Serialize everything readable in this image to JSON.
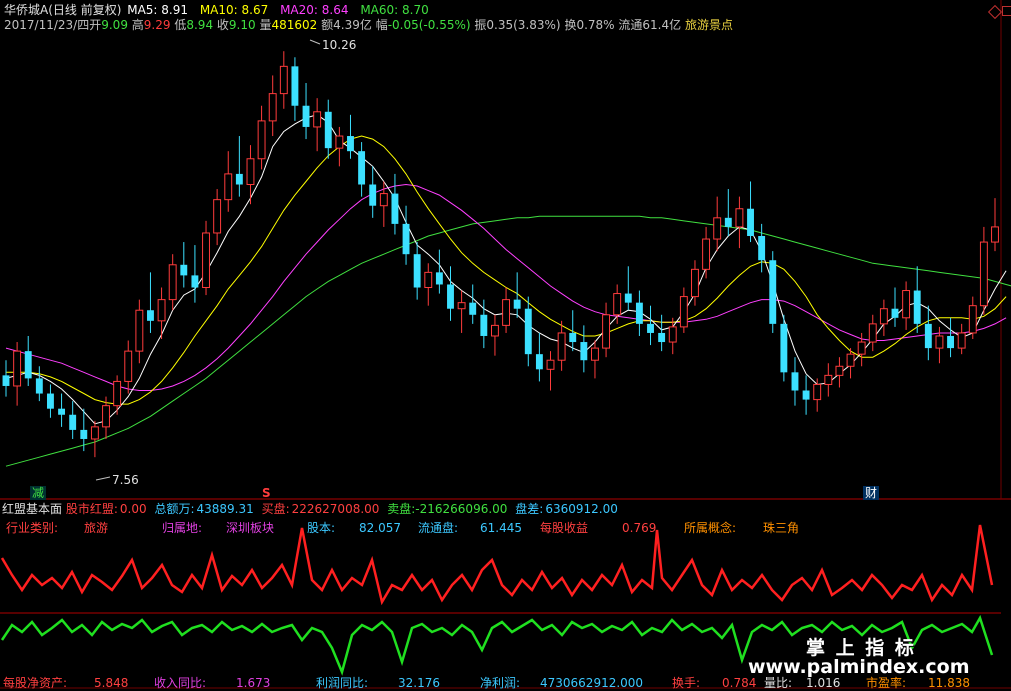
{
  "header": {
    "title": "华侨城A(日线 前复权)",
    "ma5_label": "MA5: 8.91",
    "ma10_label": "MA10: 8.67",
    "ma20_label": "MA20: 8.64",
    "ma60_label": "MA60: 8.70",
    "date": "2017/11/23/四",
    "open_label": "开",
    "open_value": "9.09",
    "high_label": "高",
    "high_value": "9.29",
    "low_label": "低",
    "low_value": "8.94",
    "close_label": "收",
    "close_value": "9.10",
    "volume_label": "量",
    "volume_value": "481602",
    "amount": "额4.39亿",
    "change_label": "幅",
    "change_value": "-0.05(-0.55%)",
    "amplitude": "振0.35(3.83%)",
    "turnover": "换0.78%",
    "float_cap": "流通61.4亿",
    "concept": "旅游景点"
  },
  "markers": {
    "max_price": "10.26",
    "min_price": "7.56",
    "event_reduce": "减",
    "event_s": "S",
    "event_finance": "财"
  },
  "indicator_bar": {
    "name": "红盟基本面",
    "item1_label": "股市红盟:",
    "item1_value": "0.00",
    "item2_label": "总额万:",
    "item2_value": "43889.31",
    "item3_label": "买盘:",
    "item3_value": "222627008.00",
    "item4_label": "卖盘:",
    "item4_value": "-216266096.00",
    "item5_label": "盘差:",
    "item5_value": "6360912.00"
  },
  "fundamentals_top": {
    "industry_label": "行业类别:",
    "industry_value": "旅游",
    "region_label": "归属地:",
    "region_value": "深圳板块",
    "shares_label": "股本:",
    "shares_value": "82.057",
    "float_label": "流通盘:",
    "float_value": "61.445",
    "eps_label": "每股收益",
    "eps_value": "0.769",
    "concept_label": "所属概念:",
    "concept_value": "珠三角"
  },
  "fundamentals_bottom": {
    "nav_label": "每股净资产:",
    "nav_value": "5.848",
    "rev_label": "收入同比:",
    "rev_value": "1.673",
    "profit_growth_label": "利润同比:",
    "profit_growth_value": "32.176",
    "net_profit_label": "净利润:",
    "net_profit_value": "4730662912.000",
    "turnover_label": "换手:",
    "turnover_value": "0.784",
    "volume_ratio_label": "量比:",
    "volume_ratio_value": "1.016",
    "pe_label": "市盈率:",
    "pe_value": "11.838"
  },
  "watermark": {
    "line1": "掌 上 指 标",
    "line2": "www.palmindex.com"
  },
  "colors": {
    "up": "#ff3c3c",
    "down": "#3ce0ff",
    "ma5": "#ffffff",
    "ma10": "#ffff00",
    "ma20": "#ff40ff",
    "ma60": "#40e040",
    "label_cyan": "#3cc8ff",
    "label_magenta": "#e040e0",
    "label_red": "#ff4040",
    "label_orange": "#ff9000",
    "label_yellow": "#e8d040"
  },
  "chart_data": {
    "type": "candlestick",
    "title": "华侨城A(日线 前复权)",
    "ylim": [
      7.35,
      10.4
    ],
    "candles": [
      {
        "o": 8.12,
        "h": 8.22,
        "l": 7.98,
        "c": 8.05
      },
      {
        "o": 8.05,
        "h": 8.34,
        "l": 7.92,
        "c": 8.28
      },
      {
        "o": 8.28,
        "h": 8.38,
        "l": 8.05,
        "c": 8.1
      },
      {
        "o": 8.1,
        "h": 8.18,
        "l": 7.95,
        "c": 8.0
      },
      {
        "o": 8.0,
        "h": 8.06,
        "l": 7.84,
        "c": 7.9
      },
      {
        "o": 7.9,
        "h": 8.0,
        "l": 7.78,
        "c": 7.86
      },
      {
        "o": 7.86,
        "h": 7.95,
        "l": 7.7,
        "c": 7.76
      },
      {
        "o": 7.76,
        "h": 7.9,
        "l": 7.62,
        "c": 7.7
      },
      {
        "o": 7.7,
        "h": 7.82,
        "l": 7.58,
        "c": 7.78
      },
      {
        "o": 7.78,
        "h": 7.98,
        "l": 7.7,
        "c": 7.92
      },
      {
        "o": 7.92,
        "h": 8.12,
        "l": 7.86,
        "c": 8.08
      },
      {
        "o": 8.08,
        "h": 8.35,
        "l": 8.0,
        "c": 8.28
      },
      {
        "o": 8.28,
        "h": 8.62,
        "l": 8.2,
        "c": 8.55
      },
      {
        "o": 8.55,
        "h": 8.8,
        "l": 8.4,
        "c": 8.48
      },
      {
        "o": 8.48,
        "h": 8.7,
        "l": 8.36,
        "c": 8.62
      },
      {
        "o": 8.62,
        "h": 8.92,
        "l": 8.55,
        "c": 8.85
      },
      {
        "o": 8.85,
        "h": 9.0,
        "l": 8.7,
        "c": 8.78
      },
      {
        "o": 8.78,
        "h": 8.98,
        "l": 8.6,
        "c": 8.7
      },
      {
        "o": 8.7,
        "h": 9.14,
        "l": 8.65,
        "c": 9.06
      },
      {
        "o": 9.06,
        "h": 9.35,
        "l": 8.98,
        "c": 9.28
      },
      {
        "o": 9.28,
        "h": 9.6,
        "l": 9.2,
        "c": 9.45
      },
      {
        "o": 9.45,
        "h": 9.7,
        "l": 9.3,
        "c": 9.38
      },
      {
        "o": 9.38,
        "h": 9.64,
        "l": 9.25,
        "c": 9.55
      },
      {
        "o": 9.55,
        "h": 9.9,
        "l": 9.48,
        "c": 9.8
      },
      {
        "o": 9.8,
        "h": 10.1,
        "l": 9.7,
        "c": 9.98
      },
      {
        "o": 9.98,
        "h": 10.26,
        "l": 9.88,
        "c": 10.16
      },
      {
        "o": 10.16,
        "h": 10.22,
        "l": 9.8,
        "c": 9.9
      },
      {
        "o": 9.9,
        "h": 10.05,
        "l": 9.68,
        "c": 9.76
      },
      {
        "o": 9.76,
        "h": 9.95,
        "l": 9.6,
        "c": 9.86
      },
      {
        "o": 9.86,
        "h": 9.94,
        "l": 9.55,
        "c": 9.62
      },
      {
        "o": 9.62,
        "h": 9.76,
        "l": 9.5,
        "c": 9.7
      },
      {
        "o": 9.7,
        "h": 9.84,
        "l": 9.55,
        "c": 9.6
      },
      {
        "o": 9.6,
        "h": 9.66,
        "l": 9.3,
        "c": 9.38
      },
      {
        "o": 9.38,
        "h": 9.5,
        "l": 9.16,
        "c": 9.24
      },
      {
        "o": 9.24,
        "h": 9.4,
        "l": 9.1,
        "c": 9.32
      },
      {
        "o": 9.32,
        "h": 9.45,
        "l": 9.05,
        "c": 9.12
      },
      {
        "o": 9.12,
        "h": 9.24,
        "l": 8.85,
        "c": 8.92
      },
      {
        "o": 8.92,
        "h": 9.0,
        "l": 8.62,
        "c": 8.7
      },
      {
        "o": 8.7,
        "h": 8.86,
        "l": 8.58,
        "c": 8.8
      },
      {
        "o": 8.8,
        "h": 8.95,
        "l": 8.66,
        "c": 8.72
      },
      {
        "o": 8.72,
        "h": 8.84,
        "l": 8.48,
        "c": 8.56
      },
      {
        "o": 8.56,
        "h": 8.68,
        "l": 8.4,
        "c": 8.6
      },
      {
        "o": 8.6,
        "h": 8.72,
        "l": 8.46,
        "c": 8.52
      },
      {
        "o": 8.52,
        "h": 8.62,
        "l": 8.3,
        "c": 8.38
      },
      {
        "o": 8.38,
        "h": 8.52,
        "l": 8.25,
        "c": 8.45
      },
      {
        "o": 8.45,
        "h": 8.7,
        "l": 8.4,
        "c": 8.62
      },
      {
        "o": 8.62,
        "h": 8.8,
        "l": 8.5,
        "c": 8.56
      },
      {
        "o": 8.56,
        "h": 8.64,
        "l": 8.18,
        "c": 8.26
      },
      {
        "o": 8.26,
        "h": 8.4,
        "l": 8.08,
        "c": 8.16
      },
      {
        "o": 8.16,
        "h": 8.28,
        "l": 8.02,
        "c": 8.22
      },
      {
        "o": 8.22,
        "h": 8.48,
        "l": 8.15,
        "c": 8.4
      },
      {
        "o": 8.4,
        "h": 8.55,
        "l": 8.28,
        "c": 8.34
      },
      {
        "o": 8.34,
        "h": 8.45,
        "l": 8.14,
        "c": 8.22
      },
      {
        "o": 8.22,
        "h": 8.35,
        "l": 8.1,
        "c": 8.3
      },
      {
        "o": 8.3,
        "h": 8.6,
        "l": 8.24,
        "c": 8.52
      },
      {
        "o": 8.52,
        "h": 8.72,
        "l": 8.46,
        "c": 8.66
      },
      {
        "o": 8.66,
        "h": 8.84,
        "l": 8.55,
        "c": 8.6
      },
      {
        "o": 8.6,
        "h": 8.68,
        "l": 8.38,
        "c": 8.46
      },
      {
        "o": 8.46,
        "h": 8.58,
        "l": 8.32,
        "c": 8.4
      },
      {
        "o": 8.4,
        "h": 8.52,
        "l": 8.28,
        "c": 8.34
      },
      {
        "o": 8.34,
        "h": 8.5,
        "l": 8.26,
        "c": 8.44
      },
      {
        "o": 8.44,
        "h": 8.7,
        "l": 8.4,
        "c": 8.64
      },
      {
        "o": 8.64,
        "h": 8.88,
        "l": 8.58,
        "c": 8.82
      },
      {
        "o": 8.82,
        "h": 9.1,
        "l": 8.76,
        "c": 9.02
      },
      {
        "o": 9.02,
        "h": 9.3,
        "l": 8.94,
        "c": 9.16
      },
      {
        "o": 9.16,
        "h": 9.35,
        "l": 9.04,
        "c": 9.1
      },
      {
        "o": 9.1,
        "h": 9.3,
        "l": 8.96,
        "c": 9.22
      },
      {
        "o": 9.22,
        "h": 9.4,
        "l": 9.0,
        "c": 9.04
      },
      {
        "o": 9.04,
        "h": 9.12,
        "l": 8.8,
        "c": 8.88
      },
      {
        "o": 8.88,
        "h": 8.94,
        "l": 8.4,
        "c": 8.46
      },
      {
        "o": 8.46,
        "h": 8.52,
        "l": 8.08,
        "c": 8.14
      },
      {
        "o": 8.14,
        "h": 8.24,
        "l": 7.92,
        "c": 8.02
      },
      {
        "o": 8.02,
        "h": 8.12,
        "l": 7.86,
        "c": 7.96
      },
      {
        "o": 7.96,
        "h": 8.1,
        "l": 7.88,
        "c": 8.06
      },
      {
        "o": 8.06,
        "h": 8.2,
        "l": 7.98,
        "c": 8.12
      },
      {
        "o": 8.12,
        "h": 8.24,
        "l": 8.04,
        "c": 8.18
      },
      {
        "o": 8.18,
        "h": 8.3,
        "l": 8.1,
        "c": 8.26
      },
      {
        "o": 8.26,
        "h": 8.4,
        "l": 8.18,
        "c": 8.34
      },
      {
        "o": 8.34,
        "h": 8.52,
        "l": 8.28,
        "c": 8.46
      },
      {
        "o": 8.46,
        "h": 8.62,
        "l": 8.38,
        "c": 8.56
      },
      {
        "o": 8.56,
        "h": 8.7,
        "l": 8.44,
        "c": 8.5
      },
      {
        "o": 8.5,
        "h": 8.74,
        "l": 8.42,
        "c": 8.68
      },
      {
        "o": 8.68,
        "h": 8.84,
        "l": 8.4,
        "c": 8.46
      },
      {
        "o": 8.46,
        "h": 8.58,
        "l": 8.22,
        "c": 8.3
      },
      {
        "o": 8.3,
        "h": 8.44,
        "l": 8.2,
        "c": 8.38
      },
      {
        "o": 8.38,
        "h": 8.5,
        "l": 8.24,
        "c": 8.3
      },
      {
        "o": 8.3,
        "h": 8.46,
        "l": 8.26,
        "c": 8.4
      },
      {
        "o": 8.4,
        "h": 8.64,
        "l": 8.36,
        "c": 8.58
      },
      {
        "o": 8.58,
        "h": 9.1,
        "l": 8.52,
        "c": 9.0
      },
      {
        "o": 9.0,
        "h": 9.29,
        "l": 8.94,
        "c": 9.1
      }
    ],
    "ma5": [
      8.1,
      8.12,
      8.14,
      8.12,
      8.08,
      8.03,
      7.96,
      7.88,
      7.8,
      7.82,
      7.89,
      7.98,
      8.1,
      8.26,
      8.39,
      8.55,
      8.65,
      8.69,
      8.8,
      8.93,
      9.07,
      9.17,
      9.29,
      9.43,
      9.63,
      9.73,
      9.78,
      9.82,
      9.84,
      9.79,
      9.67,
      9.62,
      9.56,
      9.5,
      9.4,
      9.29,
      9.13,
      8.98,
      8.92,
      8.85,
      8.74,
      8.68,
      8.63,
      8.56,
      8.52,
      8.53,
      8.52,
      8.45,
      8.4,
      8.36,
      8.34,
      8.3,
      8.27,
      8.34,
      8.43,
      8.51,
      8.55,
      8.54,
      8.49,
      8.42,
      8.44,
      8.54,
      8.66,
      8.83,
      8.95,
      9.04,
      9.1,
      9.08,
      8.94,
      8.73,
      8.49,
      8.28,
      8.13,
      8.06,
      8.07,
      8.13,
      8.19,
      8.27,
      8.36,
      8.46,
      8.51,
      8.58,
      8.6,
      8.56,
      8.48,
      8.42,
      8.37,
      8.4,
      8.55,
      8.69,
      8.81
    ],
    "ma10": [
      8.14,
      8.14,
      8.14,
      8.13,
      8.11,
      8.08,
      8.04,
      8.0,
      7.96,
      7.94,
      7.93,
      7.93,
      7.96,
      8.01,
      8.08,
      8.17,
      8.27,
      8.38,
      8.48,
      8.58,
      8.69,
      8.78,
      8.87,
      8.97,
      9.09,
      9.21,
      9.31,
      9.4,
      9.49,
      9.57,
      9.63,
      9.68,
      9.7,
      9.68,
      9.63,
      9.55,
      9.45,
      9.33,
      9.22,
      9.12,
      9.02,
      8.93,
      8.86,
      8.8,
      8.75,
      8.7,
      8.66,
      8.6,
      8.54,
      8.49,
      8.45,
      8.41,
      8.38,
      8.38,
      8.4,
      8.43,
      8.46,
      8.48,
      8.48,
      8.47,
      8.47,
      8.48,
      8.51,
      8.56,
      8.63,
      8.71,
      8.78,
      8.84,
      8.87,
      8.86,
      8.82,
      8.74,
      8.64,
      8.52,
      8.43,
      8.35,
      8.28,
      8.24,
      8.24,
      8.28,
      8.33,
      8.39,
      8.44,
      8.48,
      8.5,
      8.5,
      8.5,
      8.49,
      8.51,
      8.56,
      8.64
    ],
    "ma20": [
      8.3,
      8.28,
      8.26,
      8.24,
      8.22,
      8.2,
      8.17,
      8.14,
      8.11,
      8.08,
      8.05,
      8.03,
      8.02,
      8.02,
      8.03,
      8.05,
      8.08,
      8.12,
      8.17,
      8.23,
      8.3,
      8.38,
      8.46,
      8.55,
      8.64,
      8.74,
      8.83,
      8.92,
      9.0,
      9.08,
      9.15,
      9.22,
      9.28,
      9.32,
      9.35,
      9.37,
      9.38,
      9.37,
      9.34,
      9.31,
      9.26,
      9.21,
      9.15,
      9.09,
      9.02,
      8.95,
      8.89,
      8.83,
      8.77,
      8.71,
      8.66,
      8.61,
      8.57,
      8.54,
      8.52,
      8.51,
      8.5,
      8.49,
      8.48,
      8.47,
      8.47,
      8.47,
      8.48,
      8.49,
      8.51,
      8.54,
      8.57,
      8.6,
      8.62,
      8.62,
      8.61,
      8.58,
      8.54,
      8.5,
      8.46,
      8.42,
      8.39,
      8.36,
      8.35,
      8.35,
      8.36,
      8.37,
      8.38,
      8.39,
      8.4,
      8.4,
      8.4,
      8.41,
      8.43,
      8.46,
      8.5
    ],
    "ma60": [
      7.52,
      7.54,
      7.56,
      7.58,
      7.6,
      7.62,
      7.64,
      7.66,
      7.68,
      7.71,
      7.74,
      7.77,
      7.81,
      7.85,
      7.9,
      7.95,
      8.0,
      8.05,
      8.1,
      8.16,
      8.22,
      8.28,
      8.34,
      8.4,
      8.46,
      8.52,
      8.58,
      8.64,
      8.69,
      8.74,
      8.78,
      8.82,
      8.86,
      8.89,
      8.92,
      8.95,
      8.98,
      9.01,
      9.04,
      9.06,
      9.08,
      9.1,
      9.12,
      9.13,
      9.14,
      9.15,
      9.16,
      9.16,
      9.17,
      9.17,
      9.17,
      9.17,
      9.17,
      9.17,
      9.17,
      9.17,
      9.17,
      9.17,
      9.16,
      9.16,
      9.15,
      9.14,
      9.13,
      9.12,
      9.11,
      9.1,
      9.09,
      9.08,
      9.06,
      9.04,
      9.02,
      9.0,
      8.98,
      8.96,
      8.94,
      8.92,
      8.9,
      8.88,
      8.86,
      8.85,
      8.84,
      8.83,
      8.82,
      8.81,
      8.8,
      8.79,
      8.78,
      8.77,
      8.76,
      8.74,
      8.72,
      8.7
    ]
  }
}
